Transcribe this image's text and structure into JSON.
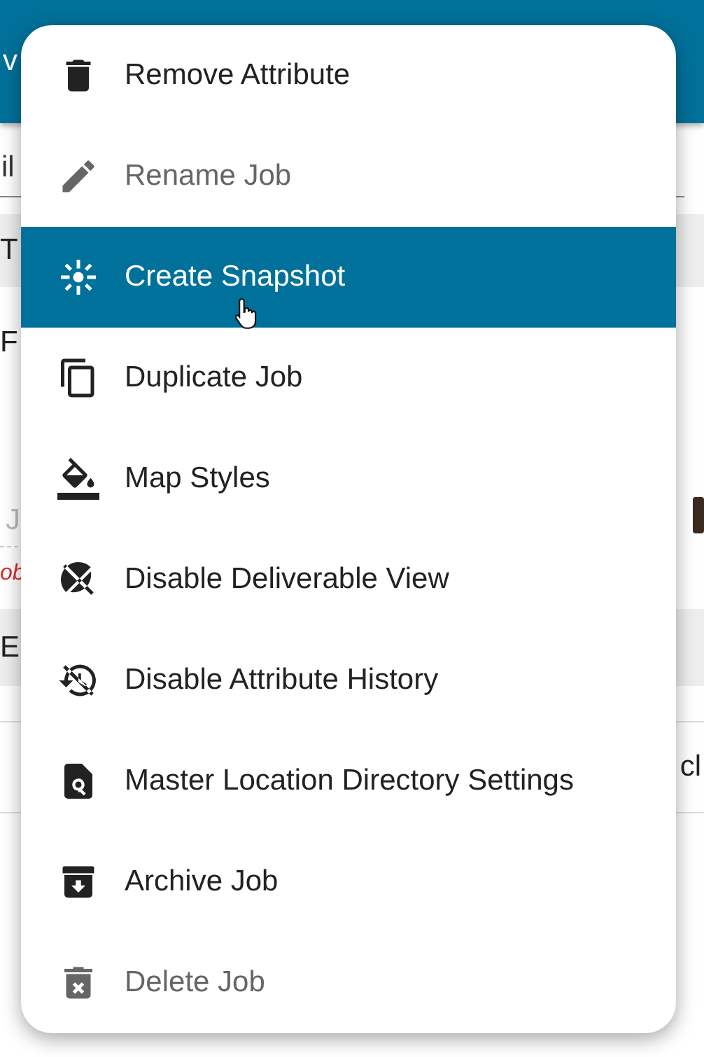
{
  "background": {
    "header_text": "v",
    "field_value": "il",
    "section_header": "T",
    "label": "F",
    "placeholder": "J",
    "error_text": "ob",
    "section_header_2": "E",
    "cell_text": "cl"
  },
  "menu": {
    "items": [
      {
        "label": "Remove Attribute",
        "selected": false,
        "disabled": false
      },
      {
        "label": "Rename Job",
        "selected": false,
        "disabled": true
      },
      {
        "label": "Create Snapshot",
        "selected": true,
        "disabled": false
      },
      {
        "label": "Duplicate Job",
        "selected": false,
        "disabled": false
      },
      {
        "label": "Map Styles",
        "selected": false,
        "disabled": false
      },
      {
        "label": "Disable Deliverable View",
        "selected": false,
        "disabled": false
      },
      {
        "label": "Disable Attribute History",
        "selected": false,
        "disabled": false
      },
      {
        "label": "Master Location Directory Settings",
        "selected": false,
        "disabled": false
      },
      {
        "label": "Archive Job",
        "selected": false,
        "disabled": false
      },
      {
        "label": "Delete Job",
        "selected": false,
        "disabled": true
      }
    ]
  }
}
